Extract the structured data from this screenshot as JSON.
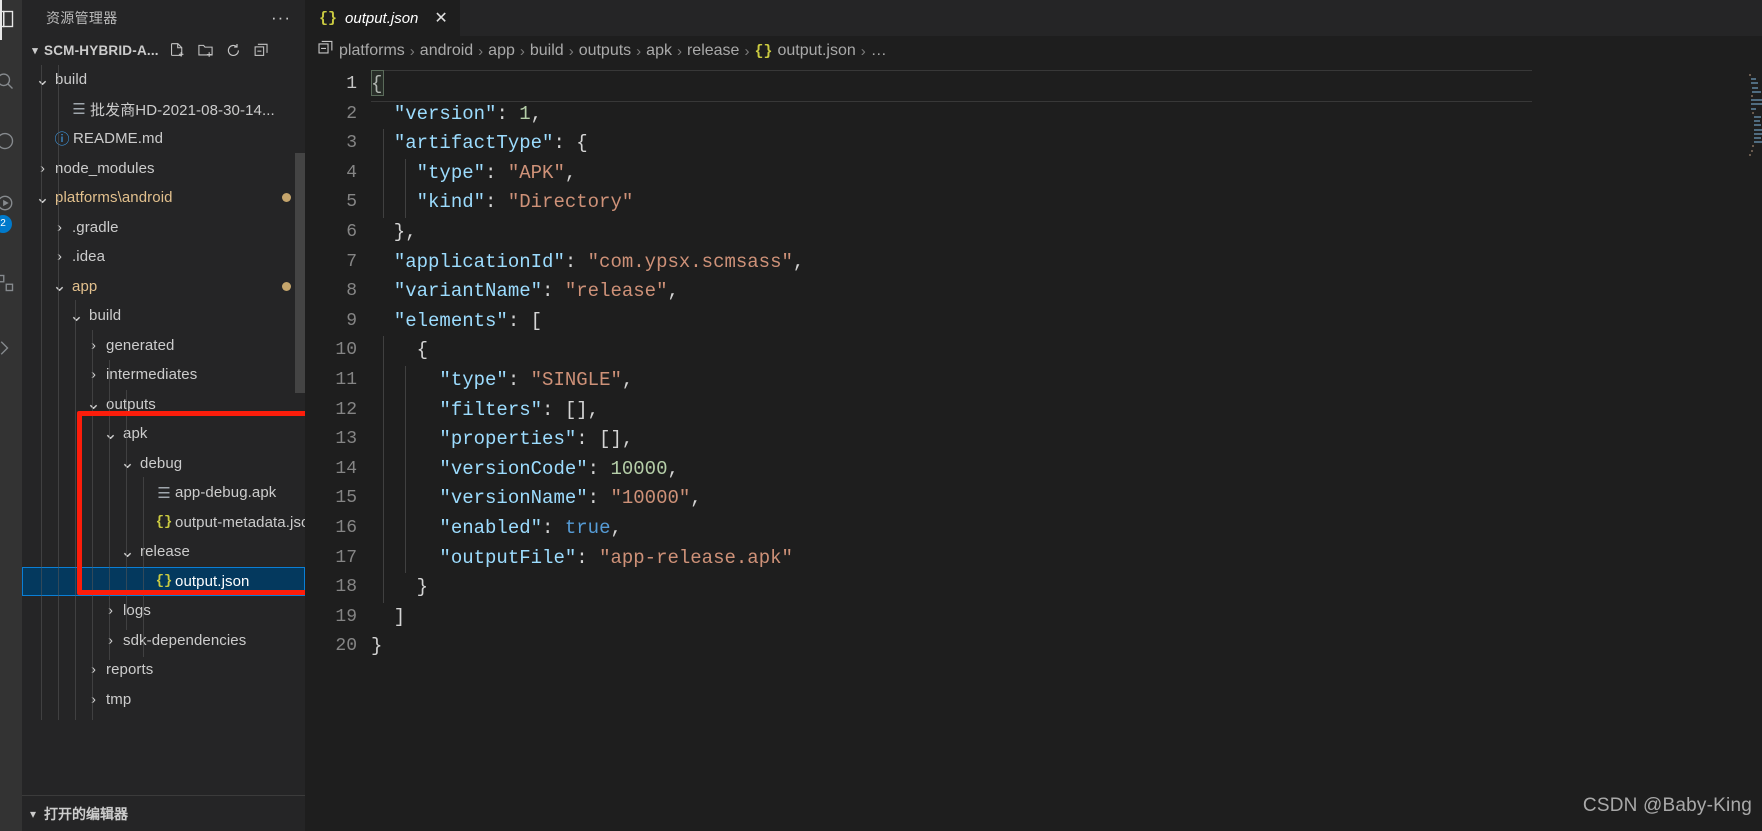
{
  "activity_bar": {
    "icons": [
      {
        "name": "explorer-icon",
        "glyph": "⎇"
      },
      {
        "name": "search-icon",
        "glyph": "○"
      },
      {
        "name": "source-control-icon",
        "glyph": "○"
      },
      {
        "name": "run-debug-icon",
        "glyph": "▷"
      },
      {
        "name": "extensions-icon",
        "glyph": "▣"
      },
      {
        "name": "remote-icon",
        "glyph": "≻"
      }
    ],
    "badge": "2"
  },
  "sidebar": {
    "title": "资源管理器",
    "more_actions": "···",
    "project": {
      "name": "SCM-HYBRID-A...",
      "actions": [
        {
          "name": "new-file-icon",
          "label": "New File"
        },
        {
          "name": "new-folder-icon",
          "label": "New Folder"
        },
        {
          "name": "refresh-icon",
          "label": "Refresh Explorer"
        },
        {
          "name": "collapse-all-icon",
          "label": "Collapse Folders"
        }
      ]
    },
    "tree": [
      {
        "label": "build",
        "indent": 1,
        "kind": "folder",
        "state": "expanded",
        "accent": false
      },
      {
        "label": "批发商HD-2021-08-30-14...",
        "indent": 2,
        "kind": "file",
        "icon": "doc"
      },
      {
        "label": "README.md",
        "indent": 1,
        "kind": "file",
        "icon": "md"
      },
      {
        "label": "node_modules",
        "indent": 1,
        "kind": "folder",
        "state": "collapsed"
      },
      {
        "label": "platforms\\android",
        "indent": 1,
        "kind": "folder",
        "state": "expanded",
        "accent": true,
        "dirty": true
      },
      {
        "label": ".gradle",
        "indent": 2,
        "kind": "folder",
        "state": "collapsed"
      },
      {
        "label": ".idea",
        "indent": 2,
        "kind": "folder",
        "state": "collapsed"
      },
      {
        "label": "app",
        "indent": 2,
        "kind": "folder",
        "state": "expanded",
        "accent": true,
        "dirty": true
      },
      {
        "label": "build",
        "indent": 3,
        "kind": "folder",
        "state": "expanded"
      },
      {
        "label": "generated",
        "indent": 4,
        "kind": "folder",
        "state": "collapsed"
      },
      {
        "label": "intermediates",
        "indent": 4,
        "kind": "folder",
        "state": "collapsed"
      },
      {
        "label": "outputs",
        "indent": 4,
        "kind": "folder",
        "state": "expanded"
      },
      {
        "label": "apk",
        "indent": 5,
        "kind": "folder",
        "state": "expanded"
      },
      {
        "label": "debug",
        "indent": 6,
        "kind": "folder",
        "state": "expanded"
      },
      {
        "label": "app-debug.apk",
        "indent": 7,
        "kind": "file",
        "icon": "doc"
      },
      {
        "label": "output-metadata.json",
        "indent": 7,
        "kind": "file",
        "icon": "json"
      },
      {
        "label": "release",
        "indent": 6,
        "kind": "folder",
        "state": "expanded"
      },
      {
        "label": "output.json",
        "indent": 7,
        "kind": "file",
        "icon": "json",
        "selected": true
      },
      {
        "label": "logs",
        "indent": 5,
        "kind": "folder",
        "state": "collapsed"
      },
      {
        "label": "sdk-dependencies",
        "indent": 5,
        "kind": "folder",
        "state": "collapsed"
      },
      {
        "label": "reports",
        "indent": 4,
        "kind": "folder",
        "state": "collapsed"
      },
      {
        "label": "tmp",
        "indent": 4,
        "kind": "folder",
        "state": "collapsed"
      }
    ],
    "open_editors_label": "打开的编辑器"
  },
  "editor": {
    "tab": {
      "icon": "{}",
      "label": "output.json",
      "close": "✕"
    },
    "breadcrumbs": [
      "platforms",
      "android",
      "app",
      "build",
      "outputs",
      "apk",
      "release"
    ],
    "breadcrumb_file": "output.json",
    "breadcrumb_more": "…",
    "separator": "›",
    "split_editor_icon": "split-editor-icon",
    "lines": [
      {
        "no": "1",
        "segments": [
          {
            "t": "{",
            "c": "p"
          }
        ]
      },
      {
        "no": "2",
        "segments": [
          {
            "t": "  ",
            "c": "p"
          },
          {
            "t": "\"version\"",
            "c": "k"
          },
          {
            "t": ": ",
            "c": "p"
          },
          {
            "t": "1",
            "c": "n"
          },
          {
            "t": ",",
            "c": "p"
          }
        ]
      },
      {
        "no": "3",
        "segments": [
          {
            "t": "  ",
            "c": "p"
          },
          {
            "t": "\"artifactType\"",
            "c": "k"
          },
          {
            "t": ": {",
            "c": "p"
          }
        ]
      },
      {
        "no": "4",
        "segments": [
          {
            "t": "    ",
            "c": "p"
          },
          {
            "t": "\"type\"",
            "c": "k"
          },
          {
            "t": ": ",
            "c": "p"
          },
          {
            "t": "\"APK\"",
            "c": "s"
          },
          {
            "t": ",",
            "c": "p"
          }
        ]
      },
      {
        "no": "5",
        "segments": [
          {
            "t": "    ",
            "c": "p"
          },
          {
            "t": "\"kind\"",
            "c": "k"
          },
          {
            "t": ": ",
            "c": "p"
          },
          {
            "t": "\"Directory\"",
            "c": "s"
          }
        ]
      },
      {
        "no": "6",
        "segments": [
          {
            "t": "  },",
            "c": "p"
          }
        ]
      },
      {
        "no": "7",
        "segments": [
          {
            "t": "  ",
            "c": "p"
          },
          {
            "t": "\"applicationId\"",
            "c": "k"
          },
          {
            "t": ": ",
            "c": "p"
          },
          {
            "t": "\"com.ypsx.scmsass\"",
            "c": "s"
          },
          {
            "t": ",",
            "c": "p"
          }
        ]
      },
      {
        "no": "8",
        "segments": [
          {
            "t": "  ",
            "c": "p"
          },
          {
            "t": "\"variantName\"",
            "c": "k"
          },
          {
            "t": ": ",
            "c": "p"
          },
          {
            "t": "\"release\"",
            "c": "s"
          },
          {
            "t": ",",
            "c": "p"
          }
        ]
      },
      {
        "no": "9",
        "segments": [
          {
            "t": "  ",
            "c": "p"
          },
          {
            "t": "\"elements\"",
            "c": "k"
          },
          {
            "t": ": [",
            "c": "p"
          }
        ]
      },
      {
        "no": "10",
        "segments": [
          {
            "t": "    {",
            "c": "p"
          }
        ]
      },
      {
        "no": "11",
        "segments": [
          {
            "t": "      ",
            "c": "p"
          },
          {
            "t": "\"type\"",
            "c": "k"
          },
          {
            "t": ": ",
            "c": "p"
          },
          {
            "t": "\"SINGLE\"",
            "c": "s"
          },
          {
            "t": ",",
            "c": "p"
          }
        ]
      },
      {
        "no": "12",
        "segments": [
          {
            "t": "      ",
            "c": "p"
          },
          {
            "t": "\"filters\"",
            "c": "k"
          },
          {
            "t": ": [],",
            "c": "p"
          }
        ]
      },
      {
        "no": "13",
        "segments": [
          {
            "t": "      ",
            "c": "p"
          },
          {
            "t": "\"properties\"",
            "c": "k"
          },
          {
            "t": ": [],",
            "c": "p"
          }
        ]
      },
      {
        "no": "14",
        "segments": [
          {
            "t": "      ",
            "c": "p"
          },
          {
            "t": "\"versionCode\"",
            "c": "k"
          },
          {
            "t": ": ",
            "c": "p"
          },
          {
            "t": "10000",
            "c": "n"
          },
          {
            "t": ",",
            "c": "p"
          }
        ]
      },
      {
        "no": "15",
        "segments": [
          {
            "t": "      ",
            "c": "p"
          },
          {
            "t": "\"versionName\"",
            "c": "k"
          },
          {
            "t": ": ",
            "c": "p"
          },
          {
            "t": "\"10000\"",
            "c": "s"
          },
          {
            "t": ",",
            "c": "p"
          }
        ]
      },
      {
        "no": "16",
        "segments": [
          {
            "t": "      ",
            "c": "p"
          },
          {
            "t": "\"enabled\"",
            "c": "k"
          },
          {
            "t": ": ",
            "c": "p"
          },
          {
            "t": "true",
            "c": "b"
          },
          {
            "t": ",",
            "c": "p"
          }
        ]
      },
      {
        "no": "17",
        "segments": [
          {
            "t": "      ",
            "c": "p"
          },
          {
            "t": "\"outputFile\"",
            "c": "k"
          },
          {
            "t": ": ",
            "c": "p"
          },
          {
            "t": "\"app-release.apk\"",
            "c": "s"
          }
        ]
      },
      {
        "no": "18",
        "segments": [
          {
            "t": "    }",
            "c": "p"
          }
        ]
      },
      {
        "no": "19",
        "segments": [
          {
            "t": "  ]",
            "c": "p"
          }
        ]
      },
      {
        "no": "20",
        "segments": [
          {
            "t": "}",
            "c": "p"
          }
        ]
      }
    ]
  },
  "watermark": "CSDN @Baby-King",
  "colors": {
    "accent": "#007acc",
    "selection": "#04395e",
    "annotation": "#fc1d0b",
    "key": "#9cdcfe",
    "string": "#ce9178",
    "number": "#b5cea8",
    "boolean": "#569cd6",
    "folder_accent": "#e2c08d"
  }
}
